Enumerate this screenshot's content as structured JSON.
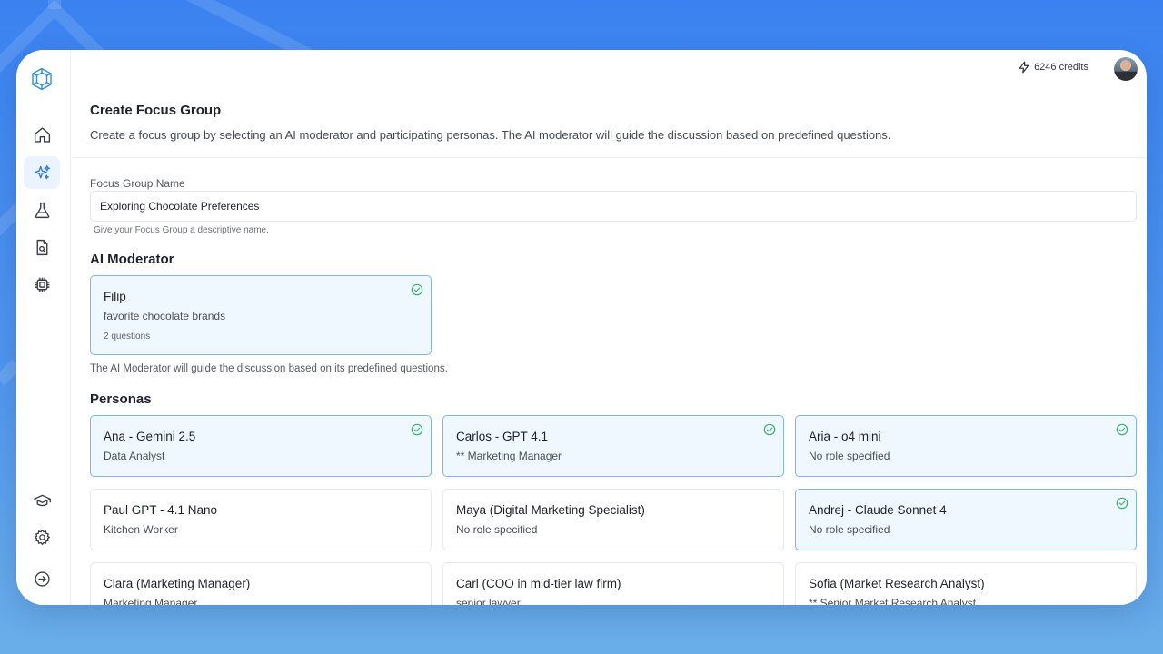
{
  "topbar": {
    "credits": "6246 credits"
  },
  "header": {
    "title": "Create Focus Group",
    "description": "Create a focus group by selecting an AI moderator and participating personas. The AI moderator will guide the discussion based on predefined questions."
  },
  "form": {
    "name_label": "Focus Group Name",
    "name_value": "Exploring Chocolate Preferences",
    "name_hint": "Give your Focus Group a descriptive name."
  },
  "moderator": {
    "section_title": "AI Moderator",
    "name": "Filip",
    "topic": "favorite chocolate brands",
    "questions": "2 questions",
    "selected": true,
    "helper": "The AI Moderator will guide the discussion based on its predefined questions."
  },
  "personas": {
    "section_title": "Personas",
    "items": [
      {
        "name": "Ana - Gemini 2.5",
        "role": "Data Analyst",
        "selected": true
      },
      {
        "name": "Carlos - GPT 4.1",
        "role": "** Marketing Manager",
        "selected": true
      },
      {
        "name": "Aria - o4 mini",
        "role": "No role specified",
        "selected": true
      },
      {
        "name": "Paul GPT - 4.1 Nano",
        "role": "Kitchen Worker",
        "selected": false
      },
      {
        "name": "Maya (Digital Marketing Specialist)",
        "role": "No role specified",
        "selected": false
      },
      {
        "name": "Andrej - Claude Sonnet 4",
        "role": "No role specified",
        "selected": true
      },
      {
        "name": "Clara (Marketing Manager)",
        "role": "Marketing Manager",
        "selected": false
      },
      {
        "name": "Carl (COO in mid-tier law firm)",
        "role": "senior lawyer",
        "selected": false
      },
      {
        "name": "Sofia (Market Research Analyst)",
        "role": "** Senior Market Research Analyst",
        "selected": false
      }
    ]
  },
  "colors": {
    "accent": "#7fb6ea",
    "selected_bg": "#eff7ff",
    "check": "#3cb371",
    "background": "#3b82f0"
  },
  "icons": {
    "logo": "app-logo-icon",
    "nav": [
      "home-icon",
      "sparkles-icon",
      "flask-icon",
      "document-search-icon",
      "chip-icon"
    ],
    "bottom": [
      "graduation-cap-icon",
      "settings-icon",
      "collapse-arrow-icon"
    ]
  }
}
